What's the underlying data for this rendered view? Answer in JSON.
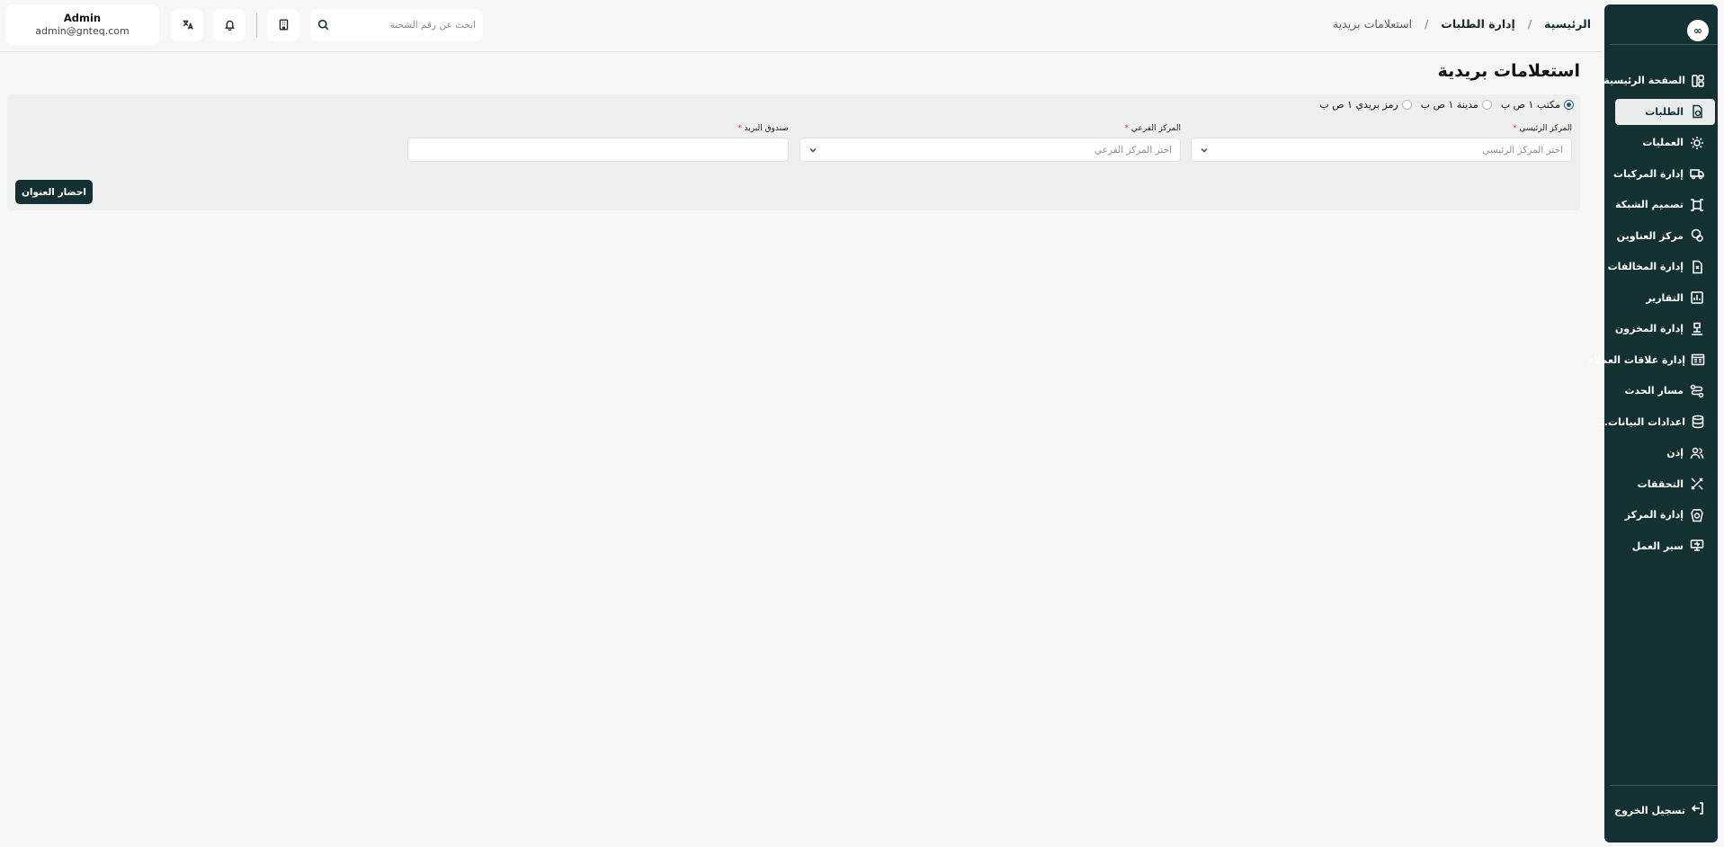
{
  "header": {
    "breadcrumb": {
      "home": "الرئيسية",
      "section": "إدارة الطلبات",
      "current": "استعلامات بريدية",
      "separator": "/"
    },
    "search_placeholder": "ابحث عن رقم الشحنة",
    "user": {
      "name": "Admin",
      "email": "admin@gnteq.com"
    }
  },
  "sidebar": {
    "items": [
      {
        "label": "الصفحة الرئيسية",
        "icon": "layout-icon"
      },
      {
        "label": "الطلبات",
        "icon": "orders-icon",
        "active": true
      },
      {
        "label": "العمليات",
        "icon": "operations-icon"
      },
      {
        "label": "إدارة المركبات",
        "icon": "truck-icon"
      },
      {
        "label": "تصميم الشبكة",
        "icon": "network-icon"
      },
      {
        "label": "مركز العناوين",
        "icon": "location-icon"
      },
      {
        "label": "إدارة المخالفات",
        "icon": "violations-icon"
      },
      {
        "label": "التقارير",
        "icon": "reports-icon"
      },
      {
        "label": "إدارة المخزون",
        "icon": "inventory-icon"
      },
      {
        "label": "إدارة علاقات العملاء",
        "icon": "crm-icon"
      },
      {
        "label": "مسار الحدث",
        "icon": "route-icon"
      },
      {
        "label": "اعدادات البيانات...",
        "icon": "database-icon"
      },
      {
        "label": "إذن",
        "icon": "users-icon"
      },
      {
        "label": "التحققات",
        "icon": "tools-icon"
      },
      {
        "label": "إدارة المركز",
        "icon": "center-icon"
      },
      {
        "label": "سير العمل",
        "icon": "workflow-icon"
      }
    ],
    "logout_label": "تسجيل الخروج"
  },
  "main": {
    "title": "استعلامات بريدية",
    "radios": [
      {
        "label": "مكتب ١ ص ب",
        "checked": true
      },
      {
        "label": "مدينة ١ ص ب",
        "checked": false
      },
      {
        "label": "رمز بريدي ١ ص ب",
        "checked": false
      }
    ],
    "fields": {
      "main_center": {
        "label": "المركز الرئيسي",
        "placeholder": "اختر المركز الرئيسي"
      },
      "sub_center": {
        "label": "المركز الفرعي",
        "placeholder": "اختر المركز الفرعي"
      },
      "po_box": {
        "label": "صندوق البريد",
        "placeholder": ""
      }
    },
    "required_mark": "*",
    "fetch_button": "احضار العنوان"
  },
  "colors": {
    "sidebar_bg": "#133033",
    "accent": "#1d5c8f",
    "required": "#dd3333"
  }
}
